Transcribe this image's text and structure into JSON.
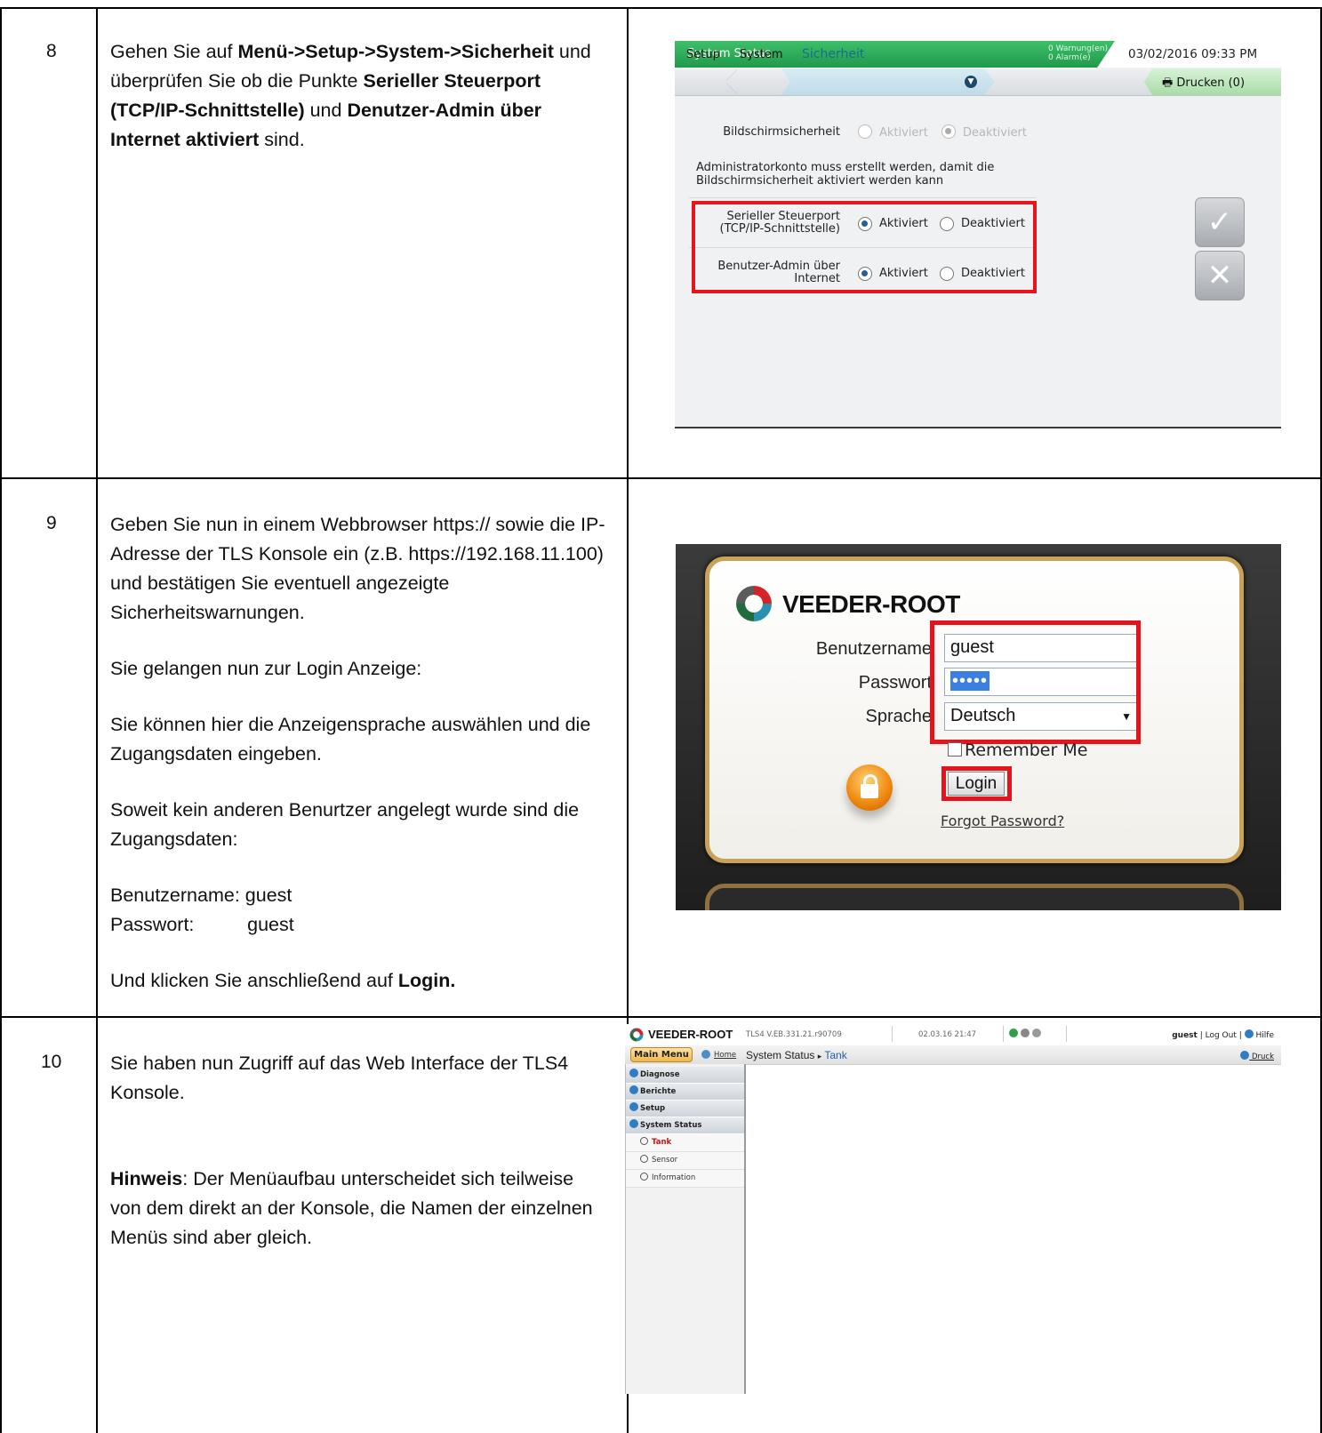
{
  "rows": [
    {
      "number": "8",
      "text": {
        "p1_a": "Gehen Sie auf ",
        "p1_b": "Menü->Setup->System->Sicherheit",
        "p1_c": " und überprüfen Sie ob die Punkte ",
        "p1_d": "Serieller Steuerport (TCP/IP-Schnittstelle)",
        "p1_e": " und ",
        "p1_f": "Denutzer-Admin über Internet aktiviert",
        "p1_g": " sind."
      }
    },
    {
      "number": "9",
      "text": {
        "p1": "Geben Sie nun in einem Webbrowser https:// sowie die IP-Adresse der TLS Konsole ein (z.B. https://192.168.11.100) und bestätigen Sie eventuell angezeigte Sicherheitswarnungen.",
        "p2": "Sie gelangen nun zur Login Anzeige:",
        "p3": "Sie können hier die Anzeigensprache auswählen und die Zugangsdaten eingeben.",
        "p4": "Soweit kein anderen Benurtzer angelegt wurde sind die Zugangsdaten:",
        "p5_a": "Benutzername: guest",
        "p5_b": "Passwort:          guest",
        "p6_a": "Und klicken Sie anschließend auf ",
        "p6_b": "Login."
      }
    },
    {
      "number": "10",
      "text": {
        "p1": "Sie haben nun Zugriff auf das Web Interface der TLS4 Konsole.",
        "p2_a": "Hinweis",
        "p2_b": ": Der Menüaufbau unterscheidet sich teilweise von dem direkt an der Konsole, die Namen der einzelnen Menüs sind aber gleich."
      }
    }
  ],
  "console": {
    "status_title": "System Status",
    "warnings": "0 Warnung(en)",
    "alarms": "0 Alarm(e)",
    "datetime": "03/02/2016 09:33 PM",
    "breadcrumbs": [
      "Setup",
      "System",
      "Sicherheit"
    ],
    "print_label": "Drucken (0)",
    "screen_security_label": "Bildschirmsicherheit",
    "option_on": "Aktiviert",
    "option_off": "Deaktiviert",
    "admin_note_1": "Administratorkonto muss erstellt werden, damit die",
    "admin_note_2": "Bildschirmsicherheit aktiviert werden kann",
    "serial_label_1": "Serieller Steuerport",
    "serial_label_2": "(TCP/IP-Schnittstelle)",
    "webadmin_label_1": "Benutzer-Admin über",
    "webadmin_label_2": "Internet",
    "screen_security_value": "Deaktiviert",
    "serial_value": "Aktiviert",
    "webadmin_value": "Aktiviert",
    "confirm_icon": "check-icon",
    "cancel_icon": "close-icon"
  },
  "login": {
    "brand": "VEEDER-ROOT",
    "username_label": "Benutzername",
    "username_value": "guest",
    "password_label": "Passwort",
    "password_mask": "•••••",
    "language_label": "Sprache",
    "language_value": "Deutsch",
    "remember_label": "Remember Me",
    "login_button": "Login",
    "forgot_link": "Forgot Password?",
    "highlight_color": "#e3141c"
  },
  "web": {
    "brand": "VEEDER-ROOT",
    "version": "TLS4 V.EB.331.21.r90709",
    "datetime": "02.03.16 21:47",
    "user": "guest",
    "logout": "Log Out",
    "help": "Hilfe",
    "main_menu": "Main Menu",
    "home": "Home",
    "crumb_parent": "System Status",
    "crumb_sep": "▸",
    "crumb_current": "Tank",
    "print": "Druck",
    "menu": [
      "Diagnose",
      "Berichte",
      "Setup",
      "System Status"
    ],
    "submenu": [
      "Tank",
      "Sensor",
      "Information"
    ]
  }
}
